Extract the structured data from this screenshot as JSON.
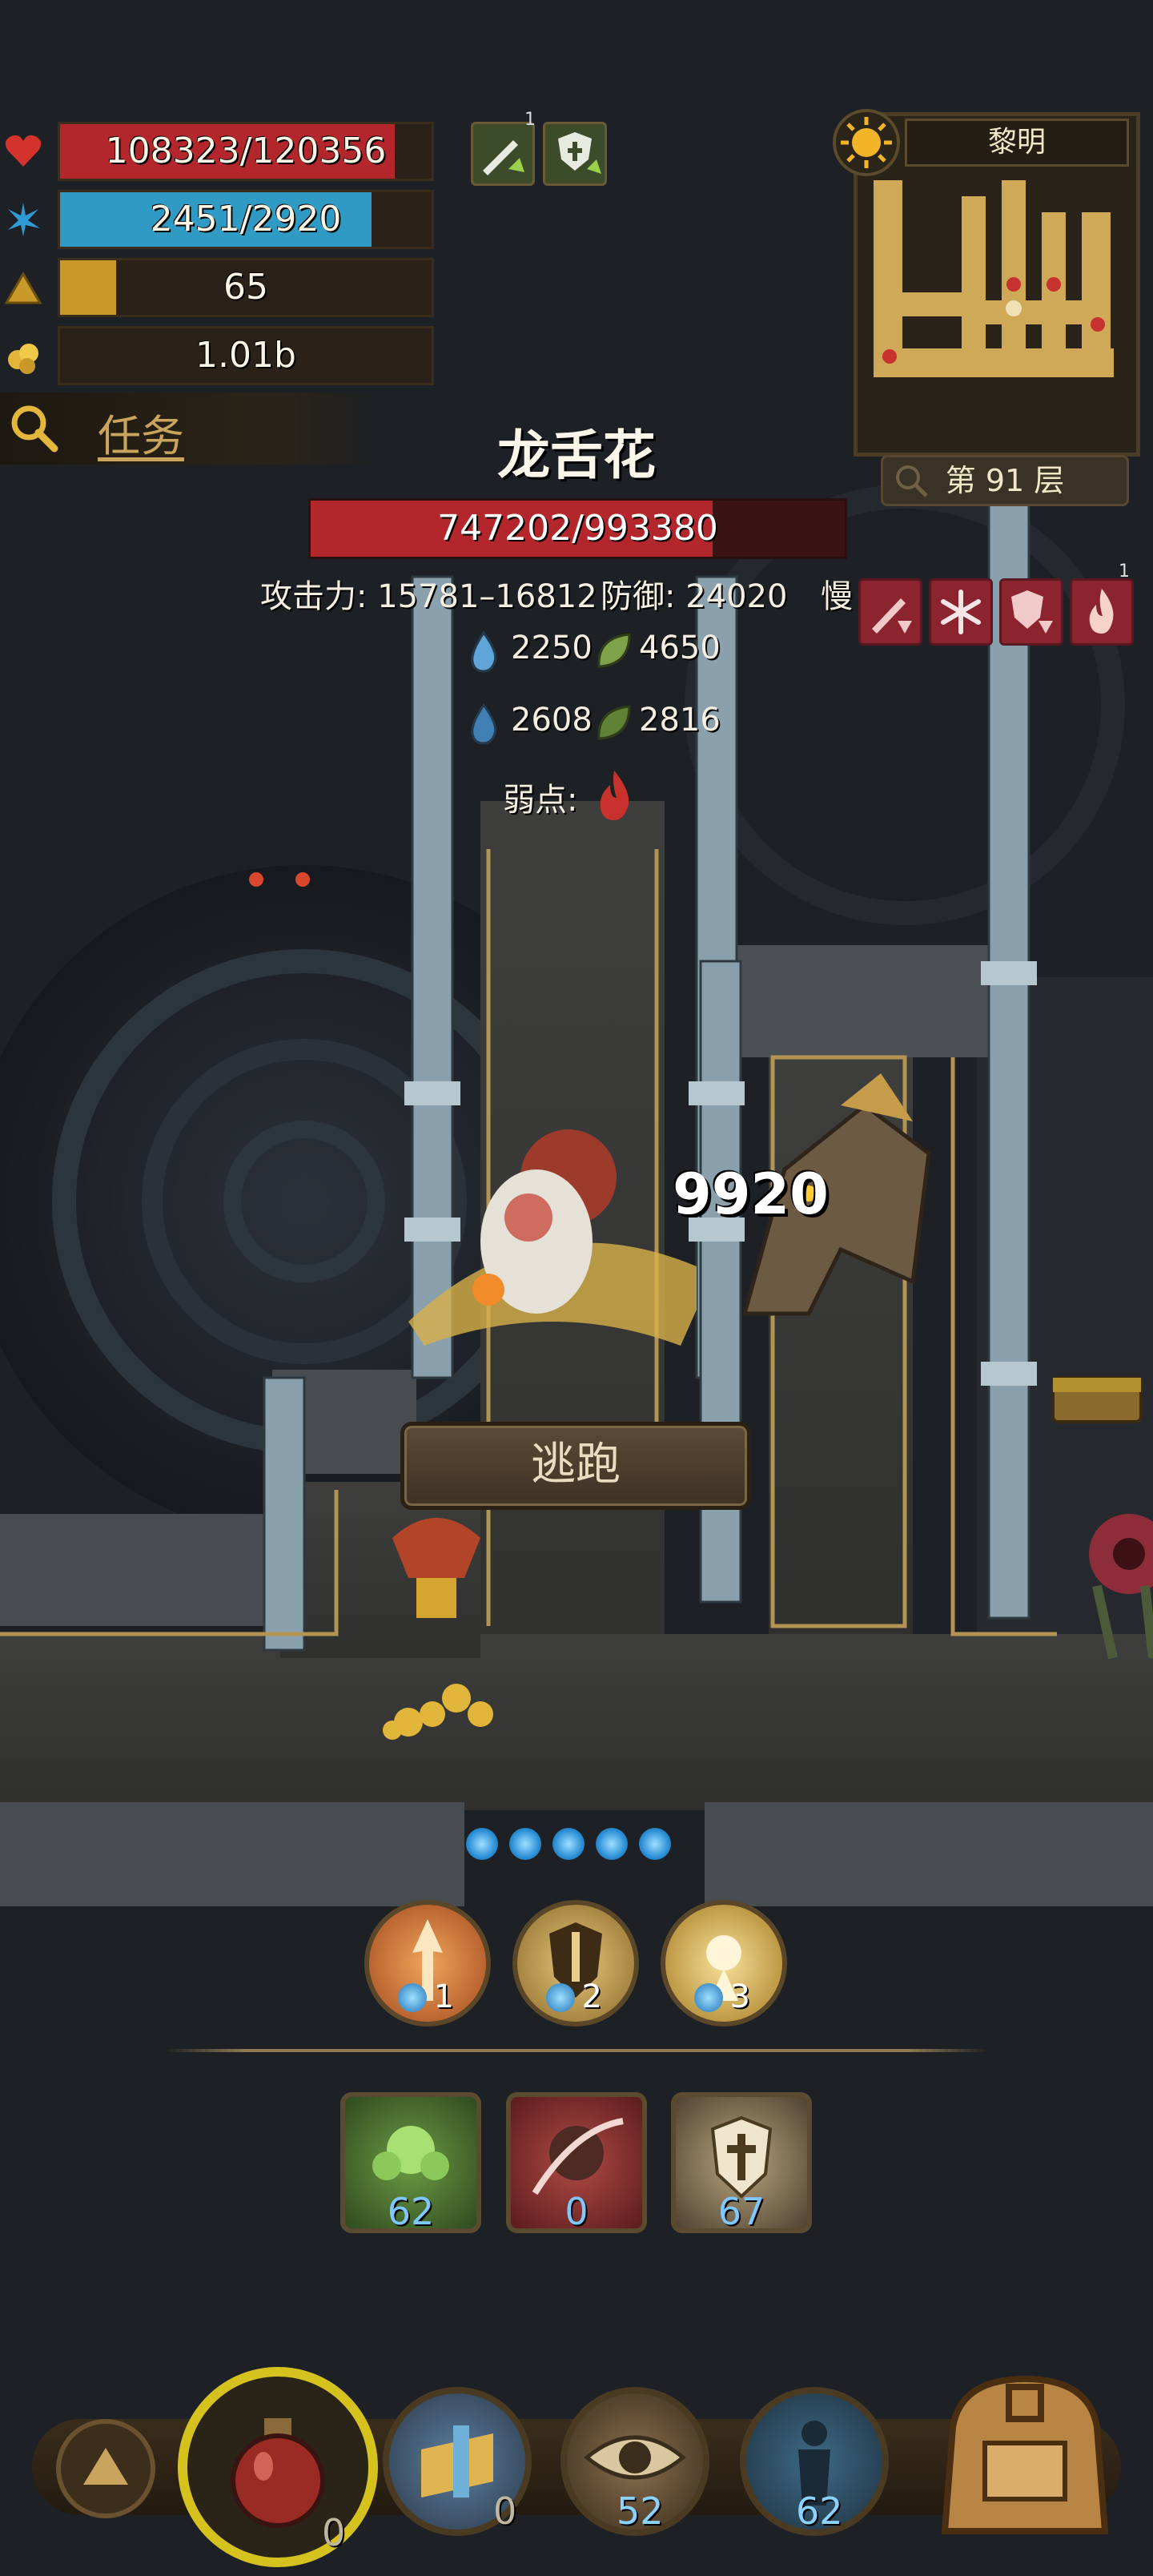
{
  "player": {
    "hp": {
      "text": "108323/120356",
      "current": 108323,
      "max": 120356
    },
    "mp": {
      "text": "2451/2920",
      "current": 2451,
      "max": 2920
    },
    "level": {
      "text": "65",
      "fill": 0.15
    },
    "gold": {
      "text": "1.01b"
    }
  },
  "buffs": [
    {
      "icon": "sword-up-icon",
      "count": "1"
    },
    {
      "icon": "shield-up-icon",
      "count": ""
    }
  ],
  "quest": {
    "label": "任务"
  },
  "minimap": {
    "time": "黎明",
    "floor": "第 91 层"
  },
  "enemy": {
    "name": "龙舌花",
    "hp_text": "747202/993380",
    "hp_current": 747202,
    "hp_max": 993380,
    "attack": "攻击力: 15781–16812",
    "defense": "防御: 24020",
    "speed": "慢",
    "resist_row1": [
      "2250",
      "4650"
    ],
    "resist_row2": [
      "2608",
      "2816"
    ],
    "weakness_label": "弱点:",
    "status_icons": [
      "attack-down-icon",
      "freeze-icon",
      "defense-down-icon",
      "burn-icon"
    ],
    "burn_count": "1"
  },
  "combat": {
    "damage": "9920",
    "flee_label": "逃跑",
    "energy_orbs": 5
  },
  "skills": [
    {
      "icon": "arrow-strike-icon",
      "cost": "1"
    },
    {
      "icon": "sword-shield-icon",
      "cost": "2"
    },
    {
      "icon": "burst-icon",
      "cost": "3"
    }
  ],
  "abilities": [
    {
      "icon": "poison-cloud-icon",
      "value": "62"
    },
    {
      "icon": "slash-icon",
      "value": "0"
    },
    {
      "icon": "holy-shield-icon",
      "value": "67"
    }
  ],
  "bottom_bar": {
    "potion_count": "0",
    "scroll_count": "0",
    "eye_count": "52",
    "figure_count": "62"
  },
  "colors": {
    "hp": "#b3262b",
    "mp": "#2f9bc4",
    "level": "#c79a2a",
    "accent": "#c9a45c"
  }
}
